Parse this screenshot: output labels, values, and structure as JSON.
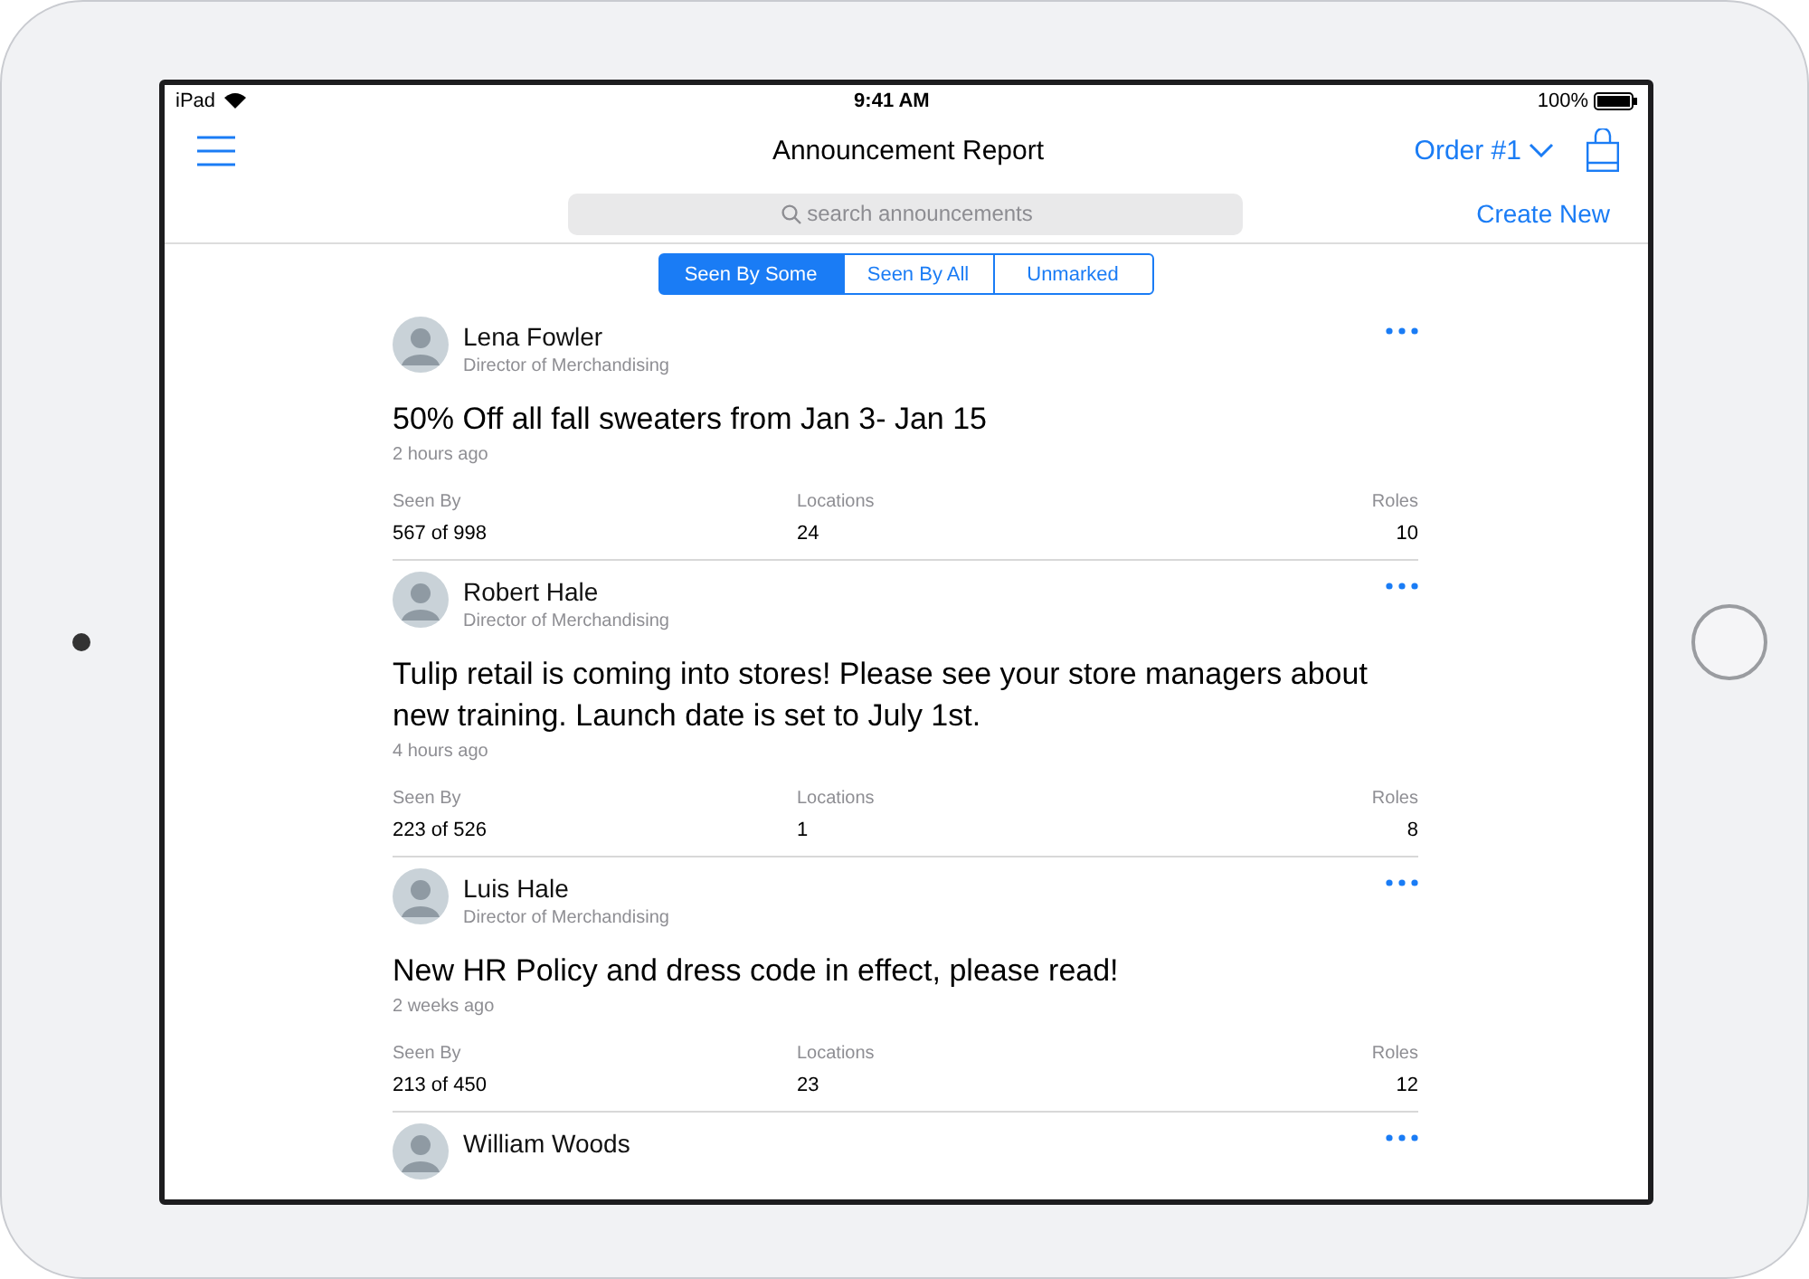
{
  "status_bar": {
    "carrier": "iPad",
    "time": "9:41 AM",
    "battery": "100%"
  },
  "nav": {
    "title": "Announcement Report",
    "order": "Order #1",
    "create": "Create New"
  },
  "search": {
    "placeholder": "search announcements"
  },
  "segments": [
    {
      "label": "Seen By Some",
      "selected": true
    },
    {
      "label": "Seen By All",
      "selected": false
    },
    {
      "label": "Unmarked",
      "selected": false
    }
  ],
  "announcements": [
    {
      "name": "Lena Fowler",
      "role": "Director of Merchandising",
      "title": "50% Off all fall sweaters from Jan 3- Jan 15",
      "time": "2 hours ago",
      "stats": [
        {
          "label": "Seen By",
          "value": "567 of 998"
        },
        {
          "label": "Locations",
          "value": "24"
        },
        {
          "label": "Roles",
          "value": "10"
        }
      ]
    },
    {
      "name": "Robert Hale",
      "role": "Director of Merchandising",
      "title": "Tulip retail is coming into stores! Please see your store managers about new training. Launch date is set to July 1st.",
      "time": "4 hours ago",
      "stats": [
        {
          "label": "Seen By",
          "value": "223 of 526"
        },
        {
          "label": "Locations",
          "value": "1"
        },
        {
          "label": "Roles",
          "value": "8"
        }
      ]
    },
    {
      "name": "Luis Hale",
      "role": "Director of Merchandising",
      "title": "New HR Policy and dress code in effect, please read!",
      "time": "2 weeks ago",
      "stats": [
        {
          "label": "Seen By",
          "value": "213 of 450"
        },
        {
          "label": "Locations",
          "value": "23"
        },
        {
          "label": "Roles",
          "value": "12"
        }
      ]
    },
    {
      "name": "William Woods"
    }
  ]
}
